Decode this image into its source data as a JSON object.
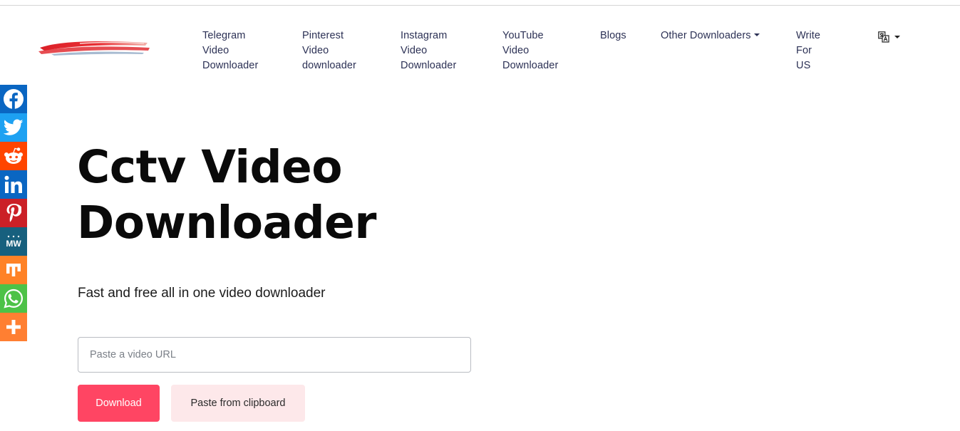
{
  "nav": {
    "items": [
      {
        "lines": [
          "Telegram",
          "Video",
          "Downloader"
        ]
      },
      {
        "lines": [
          "Pinterest",
          "Video",
          "downloader"
        ]
      },
      {
        "lines": [
          "Instagram",
          "Video",
          "Downloader"
        ]
      },
      {
        "lines": [
          "YouTube",
          "Video",
          "Downloader"
        ]
      },
      {
        "lines": [
          "Blogs"
        ]
      },
      {
        "lines": [
          "Other Downloaders"
        ]
      },
      {
        "lines": [
          "Write",
          "For",
          "US"
        ]
      }
    ],
    "text_color": "#2c3155"
  },
  "language_selector": {
    "icon": "translate-icon"
  },
  "share_bar": [
    {
      "name": "facebook-icon",
      "color": "#0a66c2"
    },
    {
      "name": "twitter-icon",
      "color": "#1da1f2"
    },
    {
      "name": "reddit-icon",
      "color": "#ff4500"
    },
    {
      "name": "linkedin-icon",
      "color": "#0a66c2"
    },
    {
      "name": "pinterest-icon",
      "color": "#cb2027"
    },
    {
      "name": "mewe-icon",
      "color": "#17607e"
    },
    {
      "name": "mix-icon",
      "color": "#ff8226"
    },
    {
      "name": "whatsapp-icon",
      "color": "#4dc247"
    },
    {
      "name": "more-icon",
      "color": "#ff7f32"
    }
  ],
  "hero": {
    "title_lines": [
      "Cctv Video",
      "Downloader"
    ],
    "subtitle": "Fast and free all in one video downloader"
  },
  "form": {
    "url_placeholder": "Paste a video URL",
    "url_value": "",
    "download_label": "Download",
    "paste_label": "Paste from clipboard"
  },
  "colors": {
    "accent": "#ff4563",
    "accent_soft": "#fde8ea"
  }
}
